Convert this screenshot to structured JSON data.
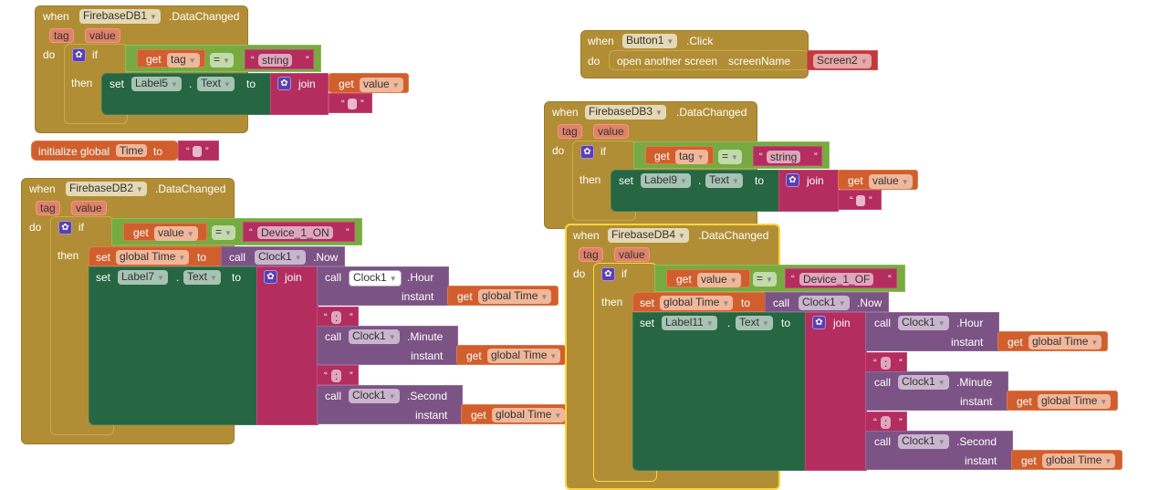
{
  "kw": {
    "when": "when",
    "do": "do",
    "if": "if",
    "then": "then",
    "set": "set",
    "to": "to",
    "join": "join",
    "get": "get",
    "call": "call",
    "instant": "instant",
    "dot": ".",
    "eq": "=",
    "initialize": "initialize global",
    "open_screen": "open another screen",
    "screen_name": "screenName",
    "tag": "tag",
    "value": "value",
    "lq": "“",
    "rq": "”"
  },
  "blocks": {
    "db1": {
      "component": "FirebaseDB1",
      "event": ".DataChanged",
      "cond_var": "tag",
      "cond_str": "string",
      "label": "Label5",
      "prop": "Text",
      "join_var": "value",
      "join_str": ""
    },
    "init": {
      "name": "Time",
      "value": ""
    },
    "db2": {
      "component": "FirebaseDB2",
      "event": ".DataChanged",
      "cond_var": "value",
      "cond_str": "Device_1_ON",
      "global_var": "global Time",
      "clock": "Clock1",
      "now": ".Now",
      "label": "Label7",
      "prop": "Text",
      "calls": [
        {
          "clock": "Clock1",
          "method": ".Hour",
          "arg": "global Time"
        },
        {
          "clock": "Clock1",
          "method": ".Minute",
          "arg": "global Time"
        },
        {
          "clock": "Clock1",
          "method": ".Second",
          "arg": "global Time"
        }
      ],
      "sep": ":"
    },
    "btn": {
      "component": "Button1",
      "event": ".Click",
      "screen": "Screen2"
    },
    "db3": {
      "component": "FirebaseDB3",
      "event": ".DataChanged",
      "cond_var": "tag",
      "cond_str": "string",
      "label": "Label9",
      "prop": "Text",
      "join_var": "value",
      "join_str": ""
    },
    "db4": {
      "component": "FirebaseDB4",
      "event": ".DataChanged",
      "cond_var": "value",
      "cond_str": "Device_1_OF",
      "global_var": "global Time",
      "clock": "Clock1",
      "now": ".Now",
      "label": "Label11",
      "prop": "Text",
      "calls": [
        {
          "clock": "Clock1",
          "method": ".Hour",
          "arg": "global Time"
        },
        {
          "clock": "Clock1",
          "method": ".Minute",
          "arg": "global Time"
        },
        {
          "clock": "Clock1",
          "method": ".Second",
          "arg": "global Time"
        }
      ],
      "sep": ":"
    }
  },
  "colors": {
    "event": "#b18e35",
    "logic": "#77ab41",
    "variable": "#d05f2d",
    "text": "#b32d5e",
    "component": "#266643",
    "call": "#7c5385",
    "screen": "#c0393b",
    "selected_outline": "#fcd53c"
  }
}
